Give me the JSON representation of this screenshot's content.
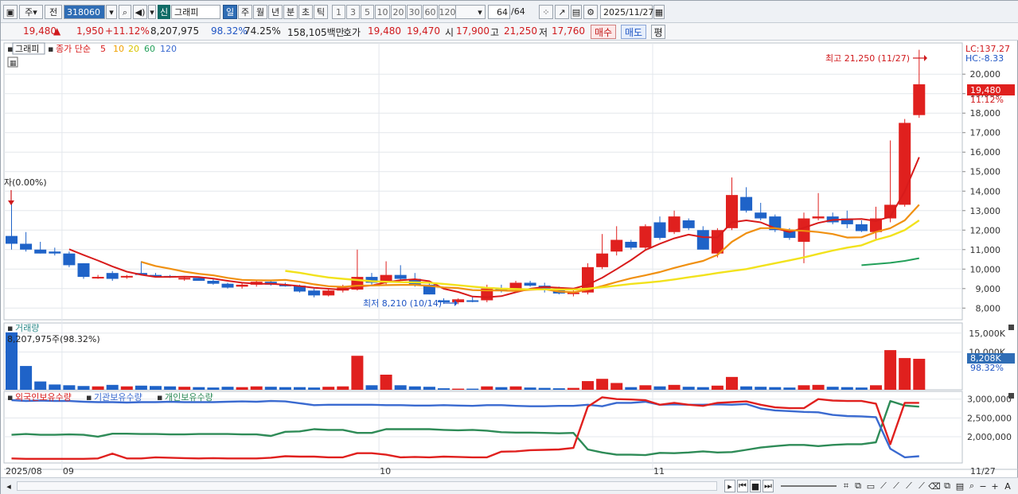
{
  "toolbar": {
    "market_kind": "주",
    "prev_label": "전",
    "code": "318060",
    "stock_badge": "신",
    "stock_name": "그래피",
    "periods": [
      "일",
      "주",
      "월",
      "년",
      "분",
      "초",
      "틱"
    ],
    "selected_period": "일",
    "intervals": [
      "1",
      "3",
      "5",
      "10",
      "20",
      "30",
      "60",
      "120"
    ],
    "count_display": "64",
    "count_total": "/64",
    "date": "2025/11/27"
  },
  "quote": {
    "price": "19,480",
    "up_mark": "▲",
    "change": "1,950",
    "change_pct": "+11.12%",
    "volume": "8,207,975",
    "vol_ratio": "98.32%",
    "turnover": "74.25%",
    "amount": "158,105백만",
    "hoga_label": "호가",
    "ask": "19,480",
    "bid": "19,470",
    "open_label": "시",
    "open": "17,900",
    "high_label": "고",
    "high": "21,250",
    "low_label": "저",
    "low": "17,760",
    "buy_label": "매수",
    "sell_label": "매도",
    "flat_label": "평"
  },
  "legend": {
    "name": "그래피",
    "price_label": "종가 단순",
    "mas": [
      {
        "period": "5",
        "color": "#d81b1b"
      },
      {
        "period": "10",
        "color": "#f0a000"
      },
      {
        "period": "20",
        "color": "#f0e000"
      },
      {
        "period": "60",
        "color": "#23a05a"
      },
      {
        "period": "120",
        "color": "#3a6ad0"
      }
    ]
  },
  "right_panel": {
    "lc": "LC:137.27",
    "hc": "HC:-8.33",
    "price_tag": "19,480",
    "pct_tag": "11.12%",
    "vol_tag": "8,208K",
    "vol_pct_tag": "98.32%"
  },
  "annotations": {
    "high_note": "최고 21,250 (11/27)",
    "low_note": "최저 8,210 (10/14)",
    "entry_note": "자(0.00%)"
  },
  "volume_panel": {
    "title": "거래량",
    "value_label": "8,207,975주(98.32%)"
  },
  "holdings_panel": {
    "series": [
      {
        "name": "외국인보유수량",
        "color": "#d81b1b"
      },
      {
        "name": "기관보유수량",
        "color": "#3a6ad0"
      },
      {
        "name": "개인보유수량",
        "color": "#2e8b57"
      }
    ]
  },
  "x_axis": {
    "labels": [
      "2025/08",
      "09",
      "10",
      "11"
    ],
    "last_date": "11/27"
  },
  "chart_data": {
    "type": "candlestick",
    "price_axis": {
      "ticks": [
        "8,000",
        "9,000",
        "10,000",
        "11,000",
        "12,000",
        "13,000",
        "14,000",
        "15,000",
        "16,000",
        "17,000",
        "18,000",
        "19,000",
        "20,000"
      ],
      "min": 7400,
      "max": 21600
    },
    "volume_axis": {
      "ticks": [
        "15,000K",
        "10,000K"
      ],
      "max": 16000
    },
    "holdings_axis": {
      "ticks": [
        "3,000,000",
        "2,500,000",
        "2,000,000"
      ],
      "min": 1300000,
      "max": 3100000
    },
    "candles": [
      {
        "date": "08/26",
        "o": 11700,
        "h": 13400,
        "l": 11000,
        "c": 11300
      },
      {
        "date": "08/27",
        "o": 11300,
        "h": 11900,
        "l": 10900,
        "c": 11000
      },
      {
        "date": "08/28",
        "o": 11000,
        "h": 11400,
        "l": 10800,
        "c": 10800
      },
      {
        "date": "08/29",
        "o": 10900,
        "h": 11100,
        "l": 10700,
        "c": 10800
      },
      {
        "date": "09/01",
        "o": 10800,
        "h": 10900,
        "l": 10100,
        "c": 10200
      },
      {
        "date": "09/02",
        "o": 10300,
        "h": 10300,
        "l": 9500,
        "c": 9600
      },
      {
        "date": "09/03",
        "o": 9600,
        "h": 9700,
        "l": 9500,
        "c": 9600
      },
      {
        "date": "09/04",
        "o": 9800,
        "h": 9900,
        "l": 9400,
        "c": 9500
      },
      {
        "date": "09/05",
        "o": 9600,
        "h": 9700,
        "l": 9500,
        "c": 9650
      },
      {
        "date": "09/08",
        "o": 9800,
        "h": 10400,
        "l": 9700,
        "c": 9700
      },
      {
        "date": "09/09",
        "o": 9700,
        "h": 9800,
        "l": 9600,
        "c": 9650
      },
      {
        "date": "09/10",
        "o": 9650,
        "h": 9700,
        "l": 9550,
        "c": 9600
      },
      {
        "date": "09/11",
        "o": 9500,
        "h": 9600,
        "l": 9400,
        "c": 9550
      },
      {
        "date": "09/12",
        "o": 9550,
        "h": 9600,
        "l": 9400,
        "c": 9400
      },
      {
        "date": "09/15",
        "o": 9400,
        "h": 9500,
        "l": 9200,
        "c": 9250
      },
      {
        "date": "09/16",
        "o": 9250,
        "h": 9300,
        "l": 9000,
        "c": 9050
      },
      {
        "date": "09/17",
        "o": 9100,
        "h": 9300,
        "l": 9000,
        "c": 9200
      },
      {
        "date": "09/18",
        "o": 9200,
        "h": 9400,
        "l": 9100,
        "c": 9350
      },
      {
        "date": "09/19",
        "o": 9350,
        "h": 9400,
        "l": 9150,
        "c": 9200
      },
      {
        "date": "09/22",
        "o": 9200,
        "h": 9300,
        "l": 9100,
        "c": 9150
      },
      {
        "date": "09/23",
        "o": 9150,
        "h": 9200,
        "l": 8800,
        "c": 8850
      },
      {
        "date": "09/24",
        "o": 8900,
        "h": 9000,
        "l": 8550,
        "c": 8650
      },
      {
        "date": "09/25",
        "o": 8650,
        "h": 9000,
        "l": 8600,
        "c": 8900
      },
      {
        "date": "09/26",
        "o": 8900,
        "h": 9200,
        "l": 8800,
        "c": 9050
      },
      {
        "date": "09/29",
        "o": 8950,
        "h": 11000,
        "l": 8900,
        "c": 9600
      },
      {
        "date": "09/30",
        "o": 9600,
        "h": 9800,
        "l": 9200,
        "c": 9300
      },
      {
        "date": "10/01",
        "o": 9300,
        "h": 10400,
        "l": 9200,
        "c": 9700
      },
      {
        "date": "10/02",
        "o": 9700,
        "h": 10200,
        "l": 9400,
        "c": 9500
      },
      {
        "date": "10/10",
        "o": 9500,
        "h": 9800,
        "l": 9100,
        "c": 9200
      },
      {
        "date": "10/13",
        "o": 9200,
        "h": 9400,
        "l": 8700,
        "c": 8700
      },
      {
        "date": "10/14",
        "o": 8400,
        "h": 8500,
        "l": 8210,
        "c": 8300
      },
      {
        "date": "10/15",
        "o": 8300,
        "h": 8500,
        "l": 8200,
        "c": 8450
      },
      {
        "date": "10/16",
        "o": 8400,
        "h": 8600,
        "l": 8300,
        "c": 8350
      },
      {
        "date": "10/17",
        "o": 8400,
        "h": 9200,
        "l": 8300,
        "c": 9000
      },
      {
        "date": "10/20",
        "o": 9000,
        "h": 9200,
        "l": 8800,
        "c": 8950
      },
      {
        "date": "10/21",
        "o": 8950,
        "h": 9400,
        "l": 8900,
        "c": 9300
      },
      {
        "date": "10/22",
        "o": 9300,
        "h": 9400,
        "l": 9100,
        "c": 9150
      },
      {
        "date": "10/23",
        "o": 9150,
        "h": 9300,
        "l": 8800,
        "c": 9000
      },
      {
        "date": "10/24",
        "o": 9000,
        "h": 9100,
        "l": 8700,
        "c": 8750
      },
      {
        "date": "10/27",
        "o": 8750,
        "h": 9000,
        "l": 8600,
        "c": 8800
      },
      {
        "date": "10/28",
        "o": 8800,
        "h": 10300,
        "l": 8700,
        "c": 10100
      },
      {
        "date": "10/29",
        "o": 10100,
        "h": 11800,
        "l": 10000,
        "c": 10800
      },
      {
        "date": "10/30",
        "o": 10900,
        "h": 12200,
        "l": 10700,
        "c": 11500
      },
      {
        "date": "10/31",
        "o": 11400,
        "h": 11500,
        "l": 11000,
        "c": 11100
      },
      {
        "date": "11/03",
        "o": 11100,
        "h": 12300,
        "l": 11000,
        "c": 12200
      },
      {
        "date": "11/04",
        "o": 12400,
        "h": 12700,
        "l": 11500,
        "c": 11600
      },
      {
        "date": "11/05",
        "o": 11900,
        "h": 13000,
        "l": 11800,
        "c": 12700
      },
      {
        "date": "11/06",
        "o": 12500,
        "h": 12600,
        "l": 12000,
        "c": 12100
      },
      {
        "date": "11/07",
        "o": 12000,
        "h": 12200,
        "l": 11000,
        "c": 11000
      },
      {
        "date": "11/10",
        "o": 10800,
        "h": 12100,
        "l": 10600,
        "c": 12000
      },
      {
        "date": "11/11",
        "o": 12100,
        "h": 14700,
        "l": 12000,
        "c": 13800
      },
      {
        "date": "11/12",
        "o": 13700,
        "h": 14200,
        "l": 12900,
        "c": 13000
      },
      {
        "date": "11/13",
        "o": 12900,
        "h": 13400,
        "l": 12500,
        "c": 12600
      },
      {
        "date": "11/14",
        "o": 12700,
        "h": 12800,
        "l": 11900,
        "c": 12000
      },
      {
        "date": "11/17",
        "o": 12000,
        "h": 12100,
        "l": 11500,
        "c": 11600
      },
      {
        "date": "11/18",
        "o": 11400,
        "h": 12900,
        "l": 10300,
        "c": 12600
      },
      {
        "date": "11/19",
        "o": 12600,
        "h": 13900,
        "l": 12500,
        "c": 12700
      },
      {
        "date": "11/20",
        "o": 12700,
        "h": 12900,
        "l": 12300,
        "c": 12400
      },
      {
        "date": "11/21",
        "o": 12600,
        "h": 13000,
        "l": 12100,
        "c": 12300
      },
      {
        "date": "11/24",
        "o": 12300,
        "h": 12500,
        "l": 11900,
        "c": 11950
      },
      {
        "date": "11/25",
        "o": 11900,
        "h": 13200,
        "l": 11500,
        "c": 12600
      },
      {
        "date": "11/26",
        "o": 12600,
        "h": 16600,
        "l": 12400,
        "c": 13300
      },
      {
        "date": "11/27",
        "o": 13300,
        "h": 17700,
        "l": 13200,
        "c": 17500
      },
      {
        "date": "11/28",
        "o": 17900,
        "h": 21250,
        "l": 17760,
        "c": 19480
      }
    ],
    "volume": [
      15200,
      6300,
      2200,
      1400,
      1200,
      1000,
      900,
      1300,
      900,
      1100,
      1000,
      900,
      800,
      700,
      600,
      800,
      700,
      900,
      800,
      700,
      700,
      600,
      800,
      900,
      9000,
      1200,
      4000,
      1200,
      900,
      800,
      400,
      300,
      300,
      900,
      700,
      900,
      600,
      500,
      400,
      500,
      2300,
      2900,
      1800,
      700,
      1200,
      900,
      1300,
      800,
      700,
      1100,
      3400,
      900,
      800,
      700,
      600,
      1200,
      1300,
      800,
      700,
      600,
      1200,
      10500,
      8400,
      8200
    ],
    "ma_lines": [
      {
        "period": "5",
        "values": [
          null,
          null,
          null,
          null,
          11020,
          10720,
          10440,
          10140,
          9870,
          9710,
          9600,
          9600,
          9610,
          9590,
          9510,
          9400,
          9300,
          9250,
          9250,
          9200,
          9130,
          9040,
          8990,
          8940,
          9100,
          9160,
          9320,
          9430,
          9480,
          9380,
          8990,
          8830,
          8590,
          8560,
          8610,
          8810,
          8990,
          9080,
          9040,
          9000,
          9200,
          9560,
          10000,
          10460,
          10980,
          11300,
          11580,
          11770,
          11640,
          11620,
          12400,
          12500,
          12400,
          12100,
          11900,
          12120,
          12370,
          12520,
          12550,
          12570,
          12470,
          12690,
          13990,
          15740
        ]
      },
      {
        "period": "10",
        "values": [
          null,
          null,
          null,
          null,
          null,
          null,
          null,
          null,
          null,
          10370,
          10160,
          10020,
          9870,
          9760,
          9680,
          9550,
          9450,
          9430,
          9420,
          9450,
          9350,
          9220,
          9120,
          9090,
          9150,
          9160,
          9180,
          9190,
          9190,
          9140,
          9060,
          9030,
          8920,
          8900,
          8900,
          8880,
          8940,
          8970,
          8850,
          8810,
          8950,
          9130,
          9340,
          9530,
          9680,
          9850,
          10060,
          10250,
          10420,
          10730,
          11400,
          11840,
          12100,
          12100,
          12000,
          11960,
          11900,
          11800,
          11620,
          11630,
          11900,
          12100,
          12500,
          13300
        ]
      },
      {
        "period": "20",
        "values": [
          null,
          null,
          null,
          null,
          null,
          null,
          null,
          null,
          null,
          null,
          null,
          null,
          null,
          null,
          null,
          null,
          null,
          null,
          null,
          9910,
          9810,
          9680,
          9570,
          9500,
          9440,
          9380,
          9350,
          9330,
          9320,
          9300,
          9240,
          9170,
          9100,
          9040,
          9000,
          8980,
          8960,
          8960,
          8960,
          8950,
          9000,
          9070,
          9150,
          9240,
          9300,
          9370,
          9470,
          9580,
          9680,
          9800,
          9900,
          10000,
          10150,
          10300,
          10450,
          10600,
          10780,
          10950,
          11100,
          11220,
          11500,
          11700,
          12000,
          12500
        ]
      },
      {
        "period": "60",
        "values": [
          null,
          null,
          null,
          null,
          null,
          null,
          null,
          null,
          null,
          null,
          null,
          null,
          null,
          null,
          null,
          null,
          null,
          null,
          null,
          null,
          null,
          null,
          null,
          null,
          null,
          null,
          null,
          null,
          null,
          null,
          null,
          null,
          null,
          null,
          null,
          null,
          null,
          null,
          null,
          null,
          null,
          null,
          null,
          null,
          null,
          null,
          null,
          null,
          null,
          null,
          null,
          null,
          null,
          null,
          null,
          null,
          null,
          null,
          null,
          10200,
          10260,
          10320,
          10420,
          10560
        ]
      }
    ],
    "holdings": {
      "foreign": [
        1420000,
        1410000,
        1410000,
        1410000,
        1410000,
        1410000,
        1420000,
        1550000,
        1420000,
        1420000,
        1450000,
        1440000,
        1430000,
        1420000,
        1430000,
        1420000,
        1420000,
        1420000,
        1440000,
        1480000,
        1470000,
        1470000,
        1450000,
        1450000,
        1560000,
        1560000,
        1520000,
        1450000,
        1460000,
        1450000,
        1470000,
        1460000,
        1450000,
        1450000,
        1600000,
        1610000,
        1640000,
        1650000,
        1660000,
        1700000,
        2800000,
        3050000,
        3000000,
        2990000,
        2970000,
        2850000,
        2900000,
        2850000,
        2820000,
        2900000,
        2920000,
        2940000,
        2850000,
        2780000,
        2760000,
        2760000,
        3000000,
        2960000,
        2950000,
        2950000,
        2880000,
        1800000,
        2900000,
        2900000
      ],
      "institution": [
        2970000,
        2950000,
        2960000,
        2950000,
        2950000,
        2930000,
        2920000,
        2920000,
        2910000,
        2920000,
        2920000,
        2930000,
        2920000,
        2920000,
        2920000,
        2930000,
        2940000,
        2930000,
        2950000,
        2940000,
        2890000,
        2840000,
        2850000,
        2850000,
        2850000,
        2850000,
        2840000,
        2840000,
        2830000,
        2830000,
        2840000,
        2830000,
        2820000,
        2840000,
        2840000,
        2820000,
        2810000,
        2810000,
        2820000,
        2820000,
        2850000,
        2810000,
        2900000,
        2900000,
        2930000,
        2850000,
        2860000,
        2850000,
        2850000,
        2860000,
        2850000,
        2870000,
        2750000,
        2700000,
        2680000,
        2660000,
        2650000,
        2580000,
        2550000,
        2540000,
        2520000,
        1680000,
        1450000,
        1480000
      ],
      "individual": [
        2050000,
        2070000,
        2050000,
        2050000,
        2060000,
        2050000,
        2000000,
        2080000,
        2080000,
        2070000,
        2070000,
        2060000,
        2060000,
        2070000,
        2070000,
        2070000,
        2060000,
        2060000,
        2020000,
        2130000,
        2140000,
        2200000,
        2180000,
        2180000,
        2100000,
        2100000,
        2200000,
        2200000,
        2200000,
        2200000,
        2180000,
        2170000,
        2180000,
        2160000,
        2120000,
        2110000,
        2110000,
        2100000,
        2090000,
        2100000,
        1660000,
        1580000,
        1520000,
        1520000,
        1510000,
        1570000,
        1560000,
        1580000,
        1610000,
        1580000,
        1590000,
        1650000,
        1710000,
        1750000,
        1780000,
        1780000,
        1750000,
        1780000,
        1800000,
        1800000,
        1850000,
        2950000,
        2830000,
        2800000
      ]
    }
  }
}
